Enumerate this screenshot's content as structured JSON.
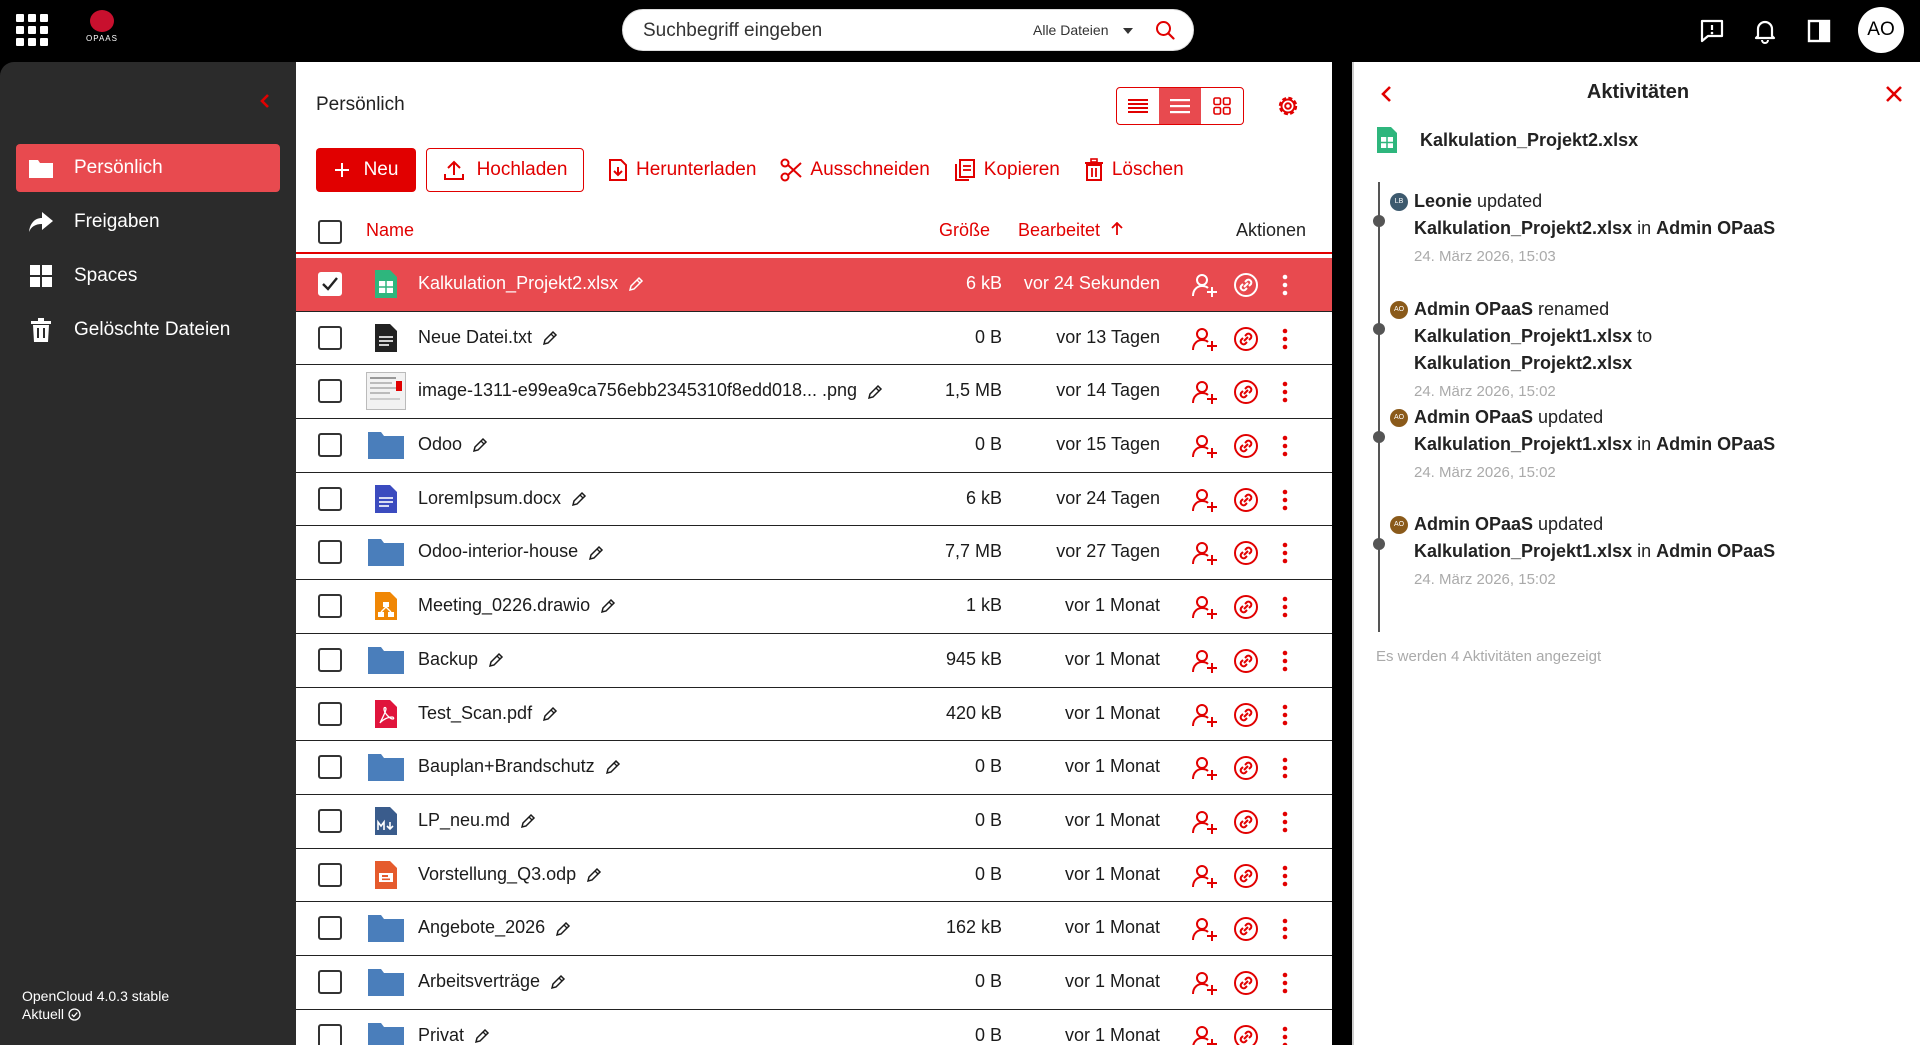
{
  "topbar": {
    "logo_text": "OPAAS",
    "search_placeholder": "Suchbegriff eingeben",
    "search_scope": "Alle Dateien",
    "avatar_initials": "AO"
  },
  "sidebar": {
    "items": [
      {
        "label": "Persönlich",
        "icon": "folder-icon",
        "active": true
      },
      {
        "label": "Freigaben",
        "icon": "share-icon",
        "active": false
      },
      {
        "label": "Spaces",
        "icon": "spaces-grid-icon",
        "active": false
      },
      {
        "label": "Gelöschte Dateien",
        "icon": "trash-icon",
        "active": false
      }
    ],
    "version": "OpenCloud 4.0.3 stable",
    "status": "Aktuell"
  },
  "main": {
    "breadcrumb": "Persönlich",
    "toolbar": {
      "new": "Neu",
      "upload": "Hochladen",
      "download": "Herunterladen",
      "cut": "Ausschneiden",
      "copy": "Kopieren",
      "delete": "Löschen"
    },
    "columns": {
      "name": "Name",
      "size": "Größe",
      "modified": "Bearbeitet",
      "actions": "Aktionen"
    },
    "files": [
      {
        "name": "Kalkulation_Projekt2.xlsx",
        "size": "6 kB",
        "modified": "vor 24 Sekunden",
        "type": "xlsx",
        "selected": true
      },
      {
        "name": "Neue Datei.txt",
        "size": "0 B",
        "modified": "vor 13 Tagen",
        "type": "txt",
        "selected": false
      },
      {
        "name": "image-1311-e99ea9ca756ebb2345310f8edd018... .png",
        "size": "1,5 MB",
        "modified": "vor 14 Tagen",
        "type": "image",
        "selected": false
      },
      {
        "name": "Odoo",
        "size": "0 B",
        "modified": "vor 15 Tagen",
        "type": "folder",
        "selected": false
      },
      {
        "name": "LoremIpsum.docx",
        "size": "6 kB",
        "modified": "vor 24 Tagen",
        "type": "docx",
        "selected": false
      },
      {
        "name": "Odoo-interior-house",
        "size": "7,7 MB",
        "modified": "vor 27 Tagen",
        "type": "folder",
        "selected": false
      },
      {
        "name": "Meeting_0226.drawio",
        "size": "1 kB",
        "modified": "vor 1 Monat",
        "type": "drawio",
        "selected": false
      },
      {
        "name": "Backup",
        "size": "945 kB",
        "modified": "vor 1 Monat",
        "type": "folder",
        "selected": false
      },
      {
        "name": "Test_Scan.pdf",
        "size": "420 kB",
        "modified": "vor 1 Monat",
        "type": "pdf",
        "selected": false
      },
      {
        "name": "Bauplan+Brandschutz",
        "size": "0 B",
        "modified": "vor 1 Monat",
        "type": "folder",
        "selected": false
      },
      {
        "name": "LP_neu.md",
        "size": "0 B",
        "modified": "vor 1 Monat",
        "type": "md",
        "selected": false
      },
      {
        "name": "Vorstellung_Q3.odp",
        "size": "0 B",
        "modified": "vor 1 Monat",
        "type": "odp",
        "selected": false
      },
      {
        "name": "Angebote_2026",
        "size": "162 kB",
        "modified": "vor 1 Monat",
        "type": "folder",
        "selected": false
      },
      {
        "name": "Arbeitsverträge",
        "size": "0 B",
        "modified": "vor 1 Monat",
        "type": "folder",
        "selected": false
      },
      {
        "name": "Privat",
        "size": "0 B",
        "modified": "vor 1 Monat",
        "type": "folder",
        "selected": false
      }
    ]
  },
  "panel": {
    "title": "Aktivitäten",
    "file": "Kalkulation_Projekt2.xlsx",
    "activities": [
      {
        "avatar": "LB",
        "avatar_color": "#3d5a6e",
        "user": "Leonie",
        "action": "updated",
        "line2_bold": "Kalkulation_Projekt2.xlsx",
        "line2_mid": "in",
        "line2_end": "Admin OPaaS",
        "line3": "",
        "date": "24. März 2026, 15:03"
      },
      {
        "avatar": "AO",
        "avatar_color": "#8a5a1a",
        "user": "Admin OPaaS",
        "action": "renamed",
        "line2_bold": "Kalkulation_Projekt1.xlsx",
        "line2_mid": "to",
        "line2_end": "",
        "line3": "Kalkulation_Projekt2.xlsx",
        "date": "24. März 2026, 15:02"
      },
      {
        "avatar": "AO",
        "avatar_color": "#8a5a1a",
        "user": "Admin OPaaS",
        "action": "updated",
        "line2_bold": "Kalkulation_Projekt1.xlsx",
        "line2_mid": "in",
        "line2_end": "Admin OPaaS",
        "line3": "",
        "date": "24. März 2026, 15:02"
      },
      {
        "avatar": "AO",
        "avatar_color": "#8a5a1a",
        "user": "Admin OPaaS",
        "action": "updated",
        "line2_bold": "Kalkulation_Projekt1.xlsx",
        "line2_mid": "in",
        "line2_end": "Admin OPaaS",
        "line3": "",
        "date": "24. März 2026, 15:02"
      }
    ],
    "footer": "Es werden 4 Aktivitäten angezeigt"
  },
  "colors": {
    "accent": "#e10000",
    "selection": "#e84a4f",
    "sidebar_bg": "#2b2b2b",
    "folder": "#4a7ebb"
  }
}
